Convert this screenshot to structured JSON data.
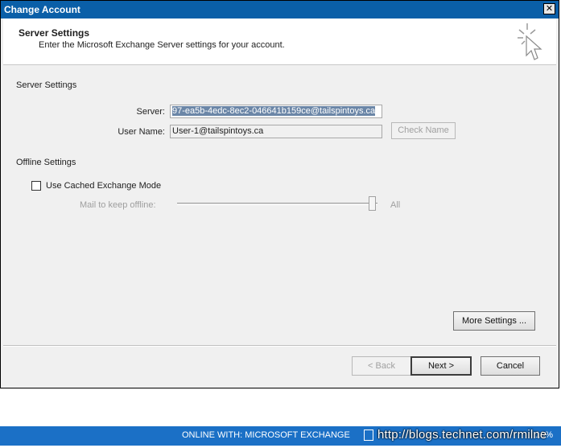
{
  "window": {
    "title": "Change Account",
    "close_glyph": "✕"
  },
  "header": {
    "title": "Server Settings",
    "subtitle": "Enter the Microsoft Exchange Server settings for your account."
  },
  "server_settings": {
    "section_label": "Server Settings",
    "server_label": "Server:",
    "server_value": "97-ea5b-4edc-8ec2-046641b159ce@tailspintoys.ca",
    "username_label": "User Name:",
    "username_value": "User-1@tailspintoys.ca",
    "check_name_label": "Check Name"
  },
  "offline_settings": {
    "section_label": "Offline Settings",
    "cached_mode_label": "Use Cached Exchange Mode",
    "cached_mode_checked": false,
    "mail_keep_label": "Mail to keep offline:",
    "mail_keep_value": "All",
    "mail_keep_level": 1.0
  },
  "buttons": {
    "more_settings": "More Settings ...",
    "back": "< Back",
    "next": "Next >",
    "cancel": "Cancel"
  },
  "statusbar": {
    "status_text": "ONLINE WITH: MICROSOFT EXCHANGE",
    "zoom": "10%"
  },
  "watermark": "http://blogs.technet.com/rmilne",
  "colors": {
    "titlebar": "#0a5fa8",
    "statusbar": "#1b70c6",
    "selection": "#6b86a7"
  }
}
